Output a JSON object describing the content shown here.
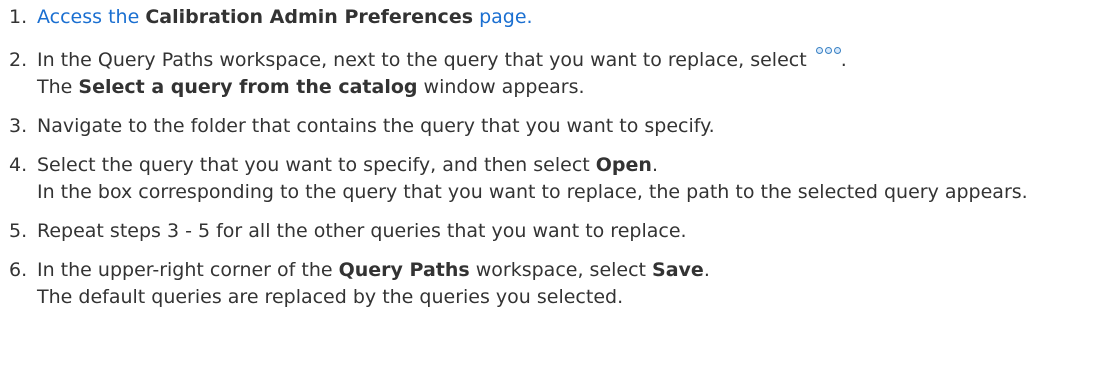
{
  "steps": [
    {
      "num": "1.",
      "link_pre": "Access the ",
      "link_bold": "Calibration Admin Preferences",
      "link_post": " page."
    },
    {
      "num": "2.",
      "text_pre": "In the Query Paths workspace, next to the query that you want to replace, select ",
      "text_post": ".",
      "icon": "more-options-icon",
      "result_pre": "The ",
      "result_bold": "Select a query from the catalog",
      "result_post": " window appears."
    },
    {
      "num": "3.",
      "text": "Navigate to the folder that contains the query that you want to specify."
    },
    {
      "num": "4.",
      "text_pre": "Select the query that you want to specify, and then select ",
      "text_bold": "Open",
      "text_post": ".",
      "result": "In the box corresponding to the query that you want to replace, the path to the selected query appears."
    },
    {
      "num": "5.",
      "text": "Repeat steps 3 - 5 for all the other queries that you want to replace."
    },
    {
      "num": "6.",
      "text_pre": "In the upper-right corner of the ",
      "text_bold": "Query Paths",
      "text_mid": " workspace, select ",
      "text_bold2": "Save",
      "text_post": ".",
      "result": "The default queries are replaced by the queries you selected."
    }
  ],
  "colors": {
    "text": "#333333",
    "link": "#1a6fd1",
    "icon": "#3b82c4"
  }
}
